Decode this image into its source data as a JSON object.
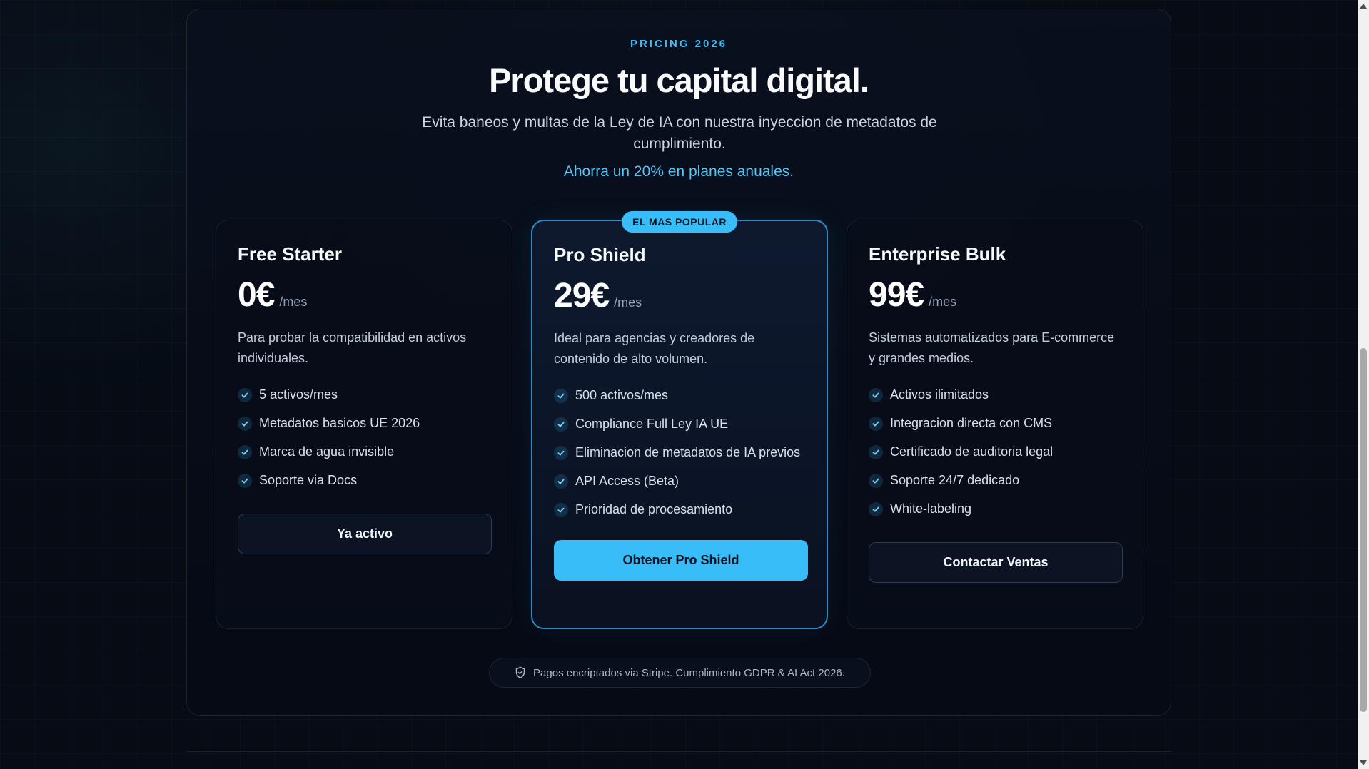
{
  "header": {
    "eyebrow": "PRICING 2026",
    "title": "Protege tu capital digital.",
    "subtitle": "Evita baneos y multas de la Ley de IA con nuestra inyeccion de metadatos de cumplimiento.",
    "savings": "Ahorra un 20% en planes anuales."
  },
  "plans": [
    {
      "name": "Free Starter",
      "price": "0€",
      "period": "/mes",
      "description": "Para probar la compatibilidad en activos individuales.",
      "features": [
        "5 activos/mes",
        "Metadatos basicos UE 2026",
        "Marca de agua invisible",
        "Soporte via Docs"
      ],
      "cta": "Ya activo"
    },
    {
      "name": "Pro Shield",
      "badge": "EL MAS POPULAR",
      "price": "29€",
      "period": "/mes",
      "description": "Ideal para agencias y creadores de contenido de alto volumen.",
      "features": [
        "500 activos/mes",
        "Compliance Full Ley IA UE",
        "Eliminacion de metadatos de IA previos",
        "API Access (Beta)",
        "Prioridad de procesamiento"
      ],
      "cta": "Obtener Pro Shield"
    },
    {
      "name": "Enterprise Bulk",
      "price": "99€",
      "period": "/mes",
      "description": "Sistemas automatizados para E-commerce y grandes medios.",
      "features": [
        "Activos ilimitados",
        "Integracion directa con CMS",
        "Certificado de auditoria legal",
        "Soporte 24/7 dedicado",
        "White-labeling"
      ],
      "cta": "Contactar Ventas"
    }
  ],
  "footer_note": {
    "icon": "shield-check-icon",
    "text": "Pagos encriptados via Stripe. Cumplimiento GDPR & AI Act 2026."
  },
  "colors": {
    "accent": "#38bdf8",
    "background": "#060b14"
  }
}
